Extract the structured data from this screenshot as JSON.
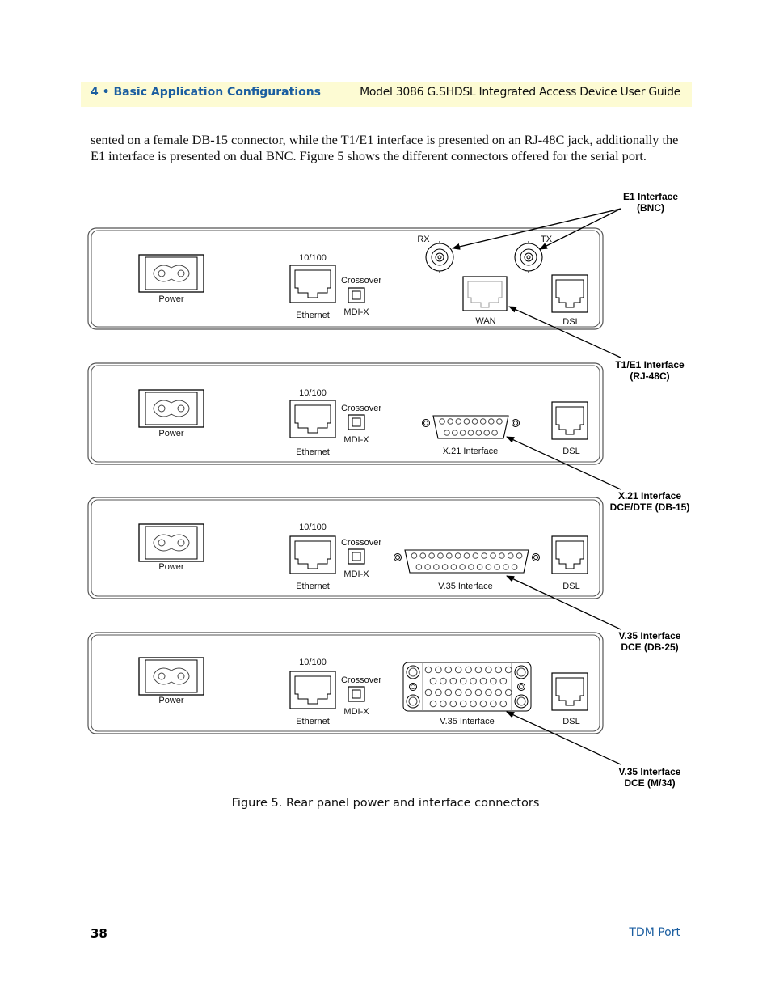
{
  "header": {
    "chapter": "4 • Basic Application Configurations",
    "guide_title": "Model 3086 G.SHDSL Integrated Access Device User Guide"
  },
  "body": {
    "paragraph_line1": "sented on a female DB-15 connector, while the T1/E1 interface is presented on an RJ-48C jack, additionally the",
    "paragraph_line2": "E1 interface is presented on dual BNC. Figure 5 shows the different connectors offered for the serial port."
  },
  "figure": {
    "caption": "Figure 5. Rear panel power and interface connectors",
    "common_labels": {
      "power": "Power",
      "speed": "10/100",
      "ethernet": "Ethernet",
      "crossover": "Crossover",
      "mdix": "MDI-X",
      "dsl": "DSL"
    },
    "panels": [
      {
        "variant": "E1/T1",
        "rx": "RX",
        "tx": "TX",
        "wan": "WAN"
      },
      {
        "variant": "X.21",
        "interface": "X.21 Interface"
      },
      {
        "variant": "V.35 DB-25",
        "interface": "V.35 Interface"
      },
      {
        "variant": "V.35 M/34",
        "interface": "V.35 Interface"
      }
    ],
    "callouts": [
      {
        "line1": "E1 Interface",
        "line2": "(BNC)"
      },
      {
        "line1": "T1/E1 Interface",
        "line2": "(RJ-48C)"
      },
      {
        "line1": "X.21 Interface",
        "line2": "DCE/DTE (DB-15)"
      },
      {
        "line1": "V.35 Interface",
        "line2": "DCE (DB-25)"
      },
      {
        "line1": "V.35 Interface",
        "line2": "DCE (M/34)"
      }
    ]
  },
  "footer": {
    "page_number": "38",
    "section": "TDM Port"
  }
}
